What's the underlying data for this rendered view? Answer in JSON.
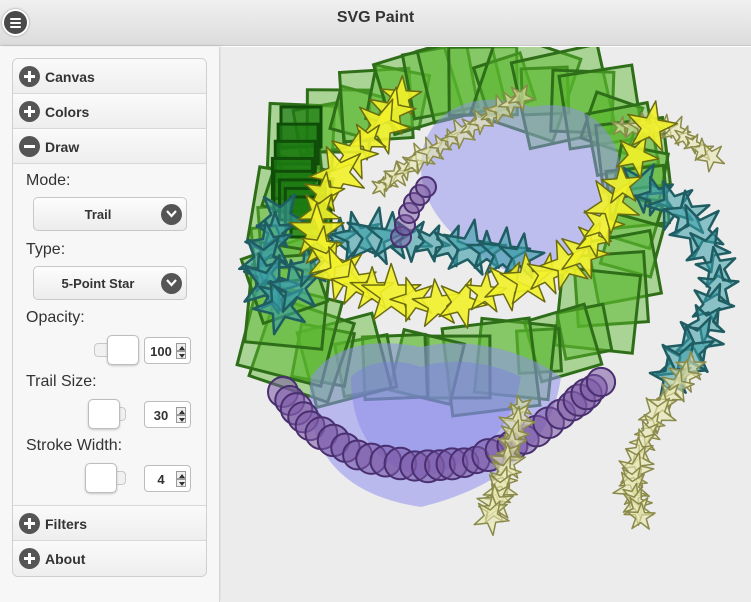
{
  "app": {
    "title": "SVG Paint"
  },
  "sections": {
    "canvas": "Canvas",
    "colors": "Colors",
    "draw": "Draw",
    "filters": "Filters",
    "about": "About"
  },
  "draw": {
    "mode": {
      "label": "Mode:",
      "value": "Trail"
    },
    "type": {
      "label": "Type:",
      "value": "5-Point Star"
    },
    "opacity": {
      "label": "Opacity:",
      "value": "100"
    },
    "trail_size": {
      "label": "Trail Size:",
      "value": "30"
    },
    "stroke_width": {
      "label": "Stroke Width:",
      "value": "4"
    }
  },
  "colors": {
    "green": "#5cb82e",
    "teal": "#3a9ea8",
    "yellow": "#f2f22a",
    "purple": "#7b5aa6",
    "periwinkle": "#8f8ff0",
    "pale": "#e8e8b0"
  }
}
